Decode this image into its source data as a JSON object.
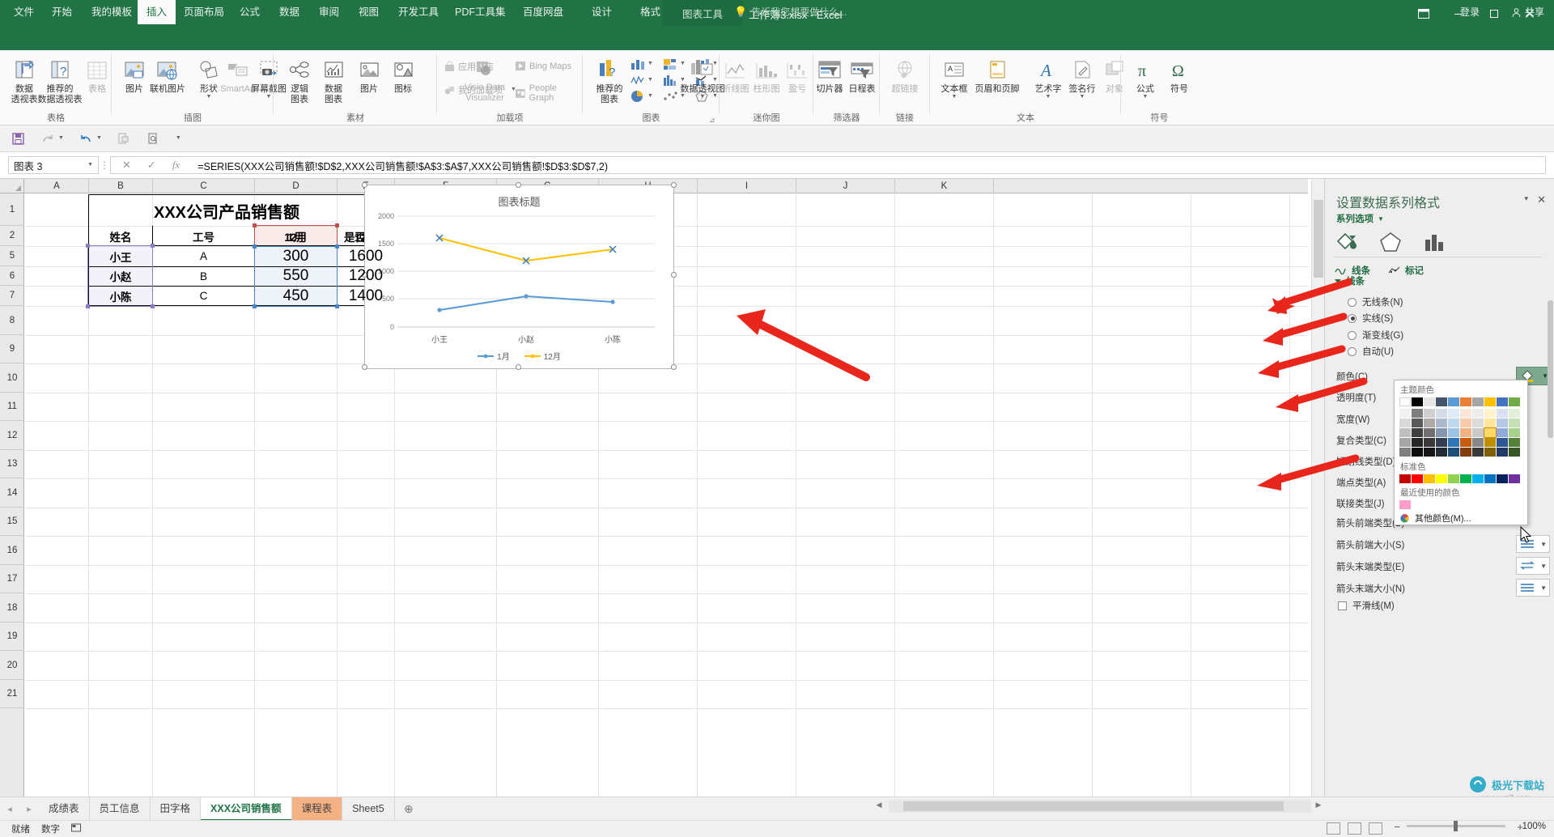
{
  "window": {
    "doc_title": "工作簿3.xlsx - Excel",
    "context_tab_group": "图表工具",
    "minimize": "–",
    "maximize": "□",
    "close": "✕"
  },
  "tabs": [
    {
      "label": "文件",
      "active": false
    },
    {
      "label": "开始",
      "active": false
    },
    {
      "label": "我的模板",
      "active": false
    },
    {
      "label": "插入",
      "active": true
    },
    {
      "label": "页面布局",
      "active": false
    },
    {
      "label": "公式",
      "active": false
    },
    {
      "label": "数据",
      "active": false
    },
    {
      "label": "审阅",
      "active": false
    },
    {
      "label": "视图",
      "active": false
    },
    {
      "label": "开发工具",
      "active": false
    },
    {
      "label": "PDF工具集",
      "active": false
    },
    {
      "label": "百度网盘",
      "active": false
    },
    {
      "label": "设计",
      "active": false
    },
    {
      "label": "格式",
      "active": false
    }
  ],
  "tellme": "告诉我您想要做什么...",
  "account": {
    "login": "登录",
    "share": "共享"
  },
  "ribbon": {
    "groups": [
      {
        "name": "表格",
        "items": [
          {
            "l1": "数据",
            "l2": "透视表",
            "icon": "pivot-table-icon",
            "disabled": false
          },
          {
            "l1": "推荐的",
            "l2": "数据透视表",
            "icon": "recommended-pivot-icon",
            "disabled": false
          },
          {
            "l1": "表格",
            "l2": "",
            "icon": "table-icon",
            "disabled": true
          }
        ]
      },
      {
        "name": "插图",
        "items": [
          {
            "l1": "图片",
            "l2": "",
            "icon": "picture-icon",
            "disabled": false
          },
          {
            "l1": "联机图片",
            "l2": "",
            "icon": "online-picture-icon",
            "disabled": false
          },
          {
            "l1": "形状",
            "l2": "",
            "icon": "shapes-icon",
            "disabled": false
          },
          {
            "l1": "SmartArt",
            "l2": "",
            "icon": "smartart-icon",
            "disabled": true
          },
          {
            "l1": "屏幕截图",
            "l2": "",
            "icon": "screenshot-icon",
            "disabled": false
          }
        ]
      },
      {
        "name": "素材",
        "items": [
          {
            "l1": "逻辑",
            "l2": "图表",
            "icon": "logic-chart-icon",
            "disabled": false
          },
          {
            "l1": "数据",
            "l2": "图表",
            "icon": "data-chart-icon",
            "disabled": false
          },
          {
            "l1": "图片",
            "l2": "",
            "icon": "material-picture-icon",
            "disabled": false
          },
          {
            "l1": "图标",
            "l2": "",
            "icon": "material-icon-icon",
            "disabled": false
          }
        ]
      },
      {
        "name": "加载项",
        "items": [
          {
            "l1": "应用商店",
            "l2": "",
            "icon": "store-icon",
            "disabled": true
          },
          {
            "l1": "我的加载项",
            "l2": "",
            "icon": "my-addins-icon",
            "disabled": true
          },
          {
            "l1": "Visio Data",
            "l2": "Visualizer",
            "icon": "visio-icon",
            "disabled": true
          },
          {
            "l1": "Bing Maps",
            "l2": "",
            "icon": "bing-maps-icon",
            "disabled": true
          },
          {
            "l1": "People Graph",
            "l2": "",
            "icon": "people-graph-icon",
            "disabled": true
          }
        ]
      },
      {
        "name": "图表",
        "items": [
          {
            "l1": "推荐的",
            "l2": "图表",
            "icon": "recommended-charts-icon",
            "disabled": false
          },
          {
            "l1": "数据透视图",
            "l2": "",
            "icon": "pivot-chart-icon",
            "disabled": false
          }
        ]
      },
      {
        "name": "迷你图",
        "items": [
          {
            "l1": "折线图",
            "l2": "",
            "icon": "sparkline-line-icon",
            "disabled": true
          },
          {
            "l1": "柱形图",
            "l2": "",
            "icon": "sparkline-column-icon",
            "disabled": true
          },
          {
            "l1": "盈亏",
            "l2": "",
            "icon": "sparkline-winloss-icon",
            "disabled": true
          }
        ]
      },
      {
        "name": "筛选器",
        "items": [
          {
            "l1": "切片器",
            "l2": "",
            "icon": "slicer-icon",
            "disabled": false
          },
          {
            "l1": "日程表",
            "l2": "",
            "icon": "timeline-icon",
            "disabled": false
          }
        ]
      },
      {
        "name": "链接",
        "items": [
          {
            "l1": "超链接",
            "l2": "",
            "icon": "hyperlink-icon",
            "disabled": true
          }
        ]
      },
      {
        "name": "文本",
        "items": [
          {
            "l1": "文本框",
            "l2": "",
            "icon": "textbox-icon",
            "disabled": false
          },
          {
            "l1": "页眉和页脚",
            "l2": "",
            "icon": "header-footer-icon",
            "disabled": false
          },
          {
            "l1": "艺术字",
            "l2": "",
            "icon": "wordart-icon",
            "disabled": false
          },
          {
            "l1": "签名行",
            "l2": "",
            "icon": "signature-line-icon",
            "disabled": false
          },
          {
            "l1": "对象",
            "l2": "",
            "icon": "object-icon",
            "disabled": true
          }
        ]
      },
      {
        "name": "符号",
        "items": [
          {
            "l1": "公式",
            "l2": "",
            "icon": "equation-icon",
            "disabled": false
          },
          {
            "l1": "符号",
            "l2": "",
            "icon": "symbol-icon",
            "disabled": false
          }
        ]
      }
    ]
  },
  "qat": [
    "save-icon",
    "redo-icon",
    "undo-icon",
    "print-preview-icon",
    "quick-print-icon"
  ],
  "formula_bar": {
    "name_box": "图表 3",
    "cancel": "✕",
    "confirm": "✓",
    "fx": "fx",
    "formula": "=SERIES(XXX公司销售额!$D$2,XXX公司销售额!$A$3:$A$7,XXX公司销售额!$D$3:$D$7,2)"
  },
  "grid": {
    "columns": [
      "A",
      "B",
      "C",
      "D",
      "E",
      "F",
      "G",
      "H",
      "I",
      "J",
      "K"
    ],
    "rows": [
      "1",
      "2",
      "5",
      "6",
      "7",
      "8",
      "9",
      "10",
      "11",
      "12",
      "13",
      "14",
      "15",
      "16",
      "17",
      "18",
      "19",
      "20",
      "21"
    ],
    "table_title": "XXX公司产品销售额",
    "headers": [
      "姓名",
      "工号",
      "1月",
      "12月",
      "是否达标"
    ],
    "data_rows": [
      {
        "name": "小王",
        "id": "A",
        "jan": "300",
        "dec": "1600",
        "ok": ""
      },
      {
        "name": "小赵",
        "id": "B",
        "jan": "550",
        "dec": "1200",
        "ok": ""
      },
      {
        "name": "小陈",
        "id": "C",
        "jan": "450",
        "dec": "1400",
        "ok": ""
      }
    ]
  },
  "chart_data": {
    "type": "line",
    "title": "图表标题",
    "categories": [
      "小王",
      "小赵",
      "小陈"
    ],
    "series": [
      {
        "name": "1月",
        "values": [
          300,
          550,
          450
        ],
        "color": "#5b9bd5"
      },
      {
        "name": "12月",
        "values": [
          1600,
          1200,
          1400
        ],
        "color": "#ffc000"
      }
    ],
    "ylim": [
      0,
      2000
    ],
    "yticks": [
      "0",
      "500",
      "1000",
      "1500",
      "2000"
    ],
    "xlabel": "",
    "ylabel": "",
    "grid": true,
    "legend_position": "bottom"
  },
  "panel": {
    "title": "设置数据系列格式",
    "subtitle": "系列选项",
    "close": "✕",
    "collapse": "▾",
    "icon_tabs": [
      "fill-line-icon",
      "effects-icon",
      "series-options-icon"
    ],
    "sub_tabs": [
      "线条",
      "标记"
    ],
    "section_line": "线条",
    "radios": [
      {
        "label": "无线条(N)",
        "selected": false
      },
      {
        "label": "实线(S)",
        "selected": true
      },
      {
        "label": "渐变线(G)",
        "selected": false
      },
      {
        "label": "自动(U)",
        "selected": false
      }
    ],
    "rows": [
      {
        "label": "颜色(C)",
        "control": "color-button"
      },
      {
        "label": "透明度(T)",
        "control": "slider"
      },
      {
        "label": "宽度(W)",
        "control": "spinner"
      },
      {
        "label": "复合类型(C)",
        "control": "dropdown"
      },
      {
        "label": "短划线类型(D)",
        "control": "dropdown"
      },
      {
        "label": "端点类型(A)",
        "control": "dropdown"
      },
      {
        "label": "联接类型(J)",
        "control": "dropdown"
      },
      {
        "label": "箭头前端类型(B)",
        "control": "dropdown"
      },
      {
        "label": "箭头前端大小(S)",
        "control": "dropdown"
      },
      {
        "label": "箭头末端类型(E)",
        "control": "dropdown"
      },
      {
        "label": "箭头末端大小(N)",
        "control": "dropdown"
      }
    ],
    "checkbox": {
      "label": "平滑线(M)",
      "checked": false
    }
  },
  "color_picker": {
    "theme_header": "主题颜色",
    "standard_header": "标准色",
    "recent_header": "最近使用的颜色",
    "more_colors": "其他颜色(M)...",
    "theme_base": [
      "#ffffff",
      "#000000",
      "#e7e6e6",
      "#44546a",
      "#5b9bd5",
      "#ed7d31",
      "#a5a5a5",
      "#ffc000",
      "#4472c4",
      "#70ad47"
    ],
    "theme_shades": [
      [
        "#f2f2f2",
        "#7f7f7f",
        "#d0cece",
        "#d6dce5",
        "#deebf7",
        "#fbe5d6",
        "#ededed",
        "#fff2cc",
        "#d9e2f3",
        "#e2efda"
      ],
      [
        "#d9d9d9",
        "#595959",
        "#aeaaaa",
        "#acb9ca",
        "#bdd7ee",
        "#f8cbad",
        "#dbdbdb",
        "#ffe699",
        "#b4c7e7",
        "#c5e0b4"
      ],
      [
        "#bfbfbf",
        "#3f3f3f",
        "#757070",
        "#8497b0",
        "#9dc3e6",
        "#f4b183",
        "#c9c9c9",
        "#ffd966",
        "#8faadc",
        "#a9d18e"
      ],
      [
        "#a6a6a6",
        "#262626",
        "#3a3838",
        "#333f50",
        "#2e75b6",
        "#c55a11",
        "#878787",
        "#bf8f00",
        "#2f5597",
        "#538135"
      ],
      [
        "#808080",
        "#0d0d0d",
        "#171616",
        "#222a35",
        "#1f4e79",
        "#833c0c",
        "#3b3838",
        "#7f6000",
        "#1f3864",
        "#375623"
      ]
    ],
    "standard": [
      "#c00000",
      "#ff0000",
      "#ffc000",
      "#ffff00",
      "#92d050",
      "#00b050",
      "#00b0f0",
      "#0070c0",
      "#002060",
      "#7030a0"
    ],
    "recent": [
      "#ff9ecb"
    ],
    "selected_swatch": {
      "row": 3,
      "col": 7,
      "hex": "#ffd966"
    }
  },
  "sheet_tabs": [
    {
      "label": "成绩表",
      "state": "normal"
    },
    {
      "label": "员工信息",
      "state": "normal"
    },
    {
      "label": "田字格",
      "state": "normal"
    },
    {
      "label": "XXX公司销售额",
      "state": "active"
    },
    {
      "label": "课程表",
      "state": "orange"
    },
    {
      "label": "Sheet5",
      "state": "normal"
    }
  ],
  "status_bar": {
    "ready": "就绪",
    "mode": "数字",
    "zoom": "100%"
  },
  "watermark": {
    "title": "极光下载站",
    "sub": "www.xz7.com"
  }
}
